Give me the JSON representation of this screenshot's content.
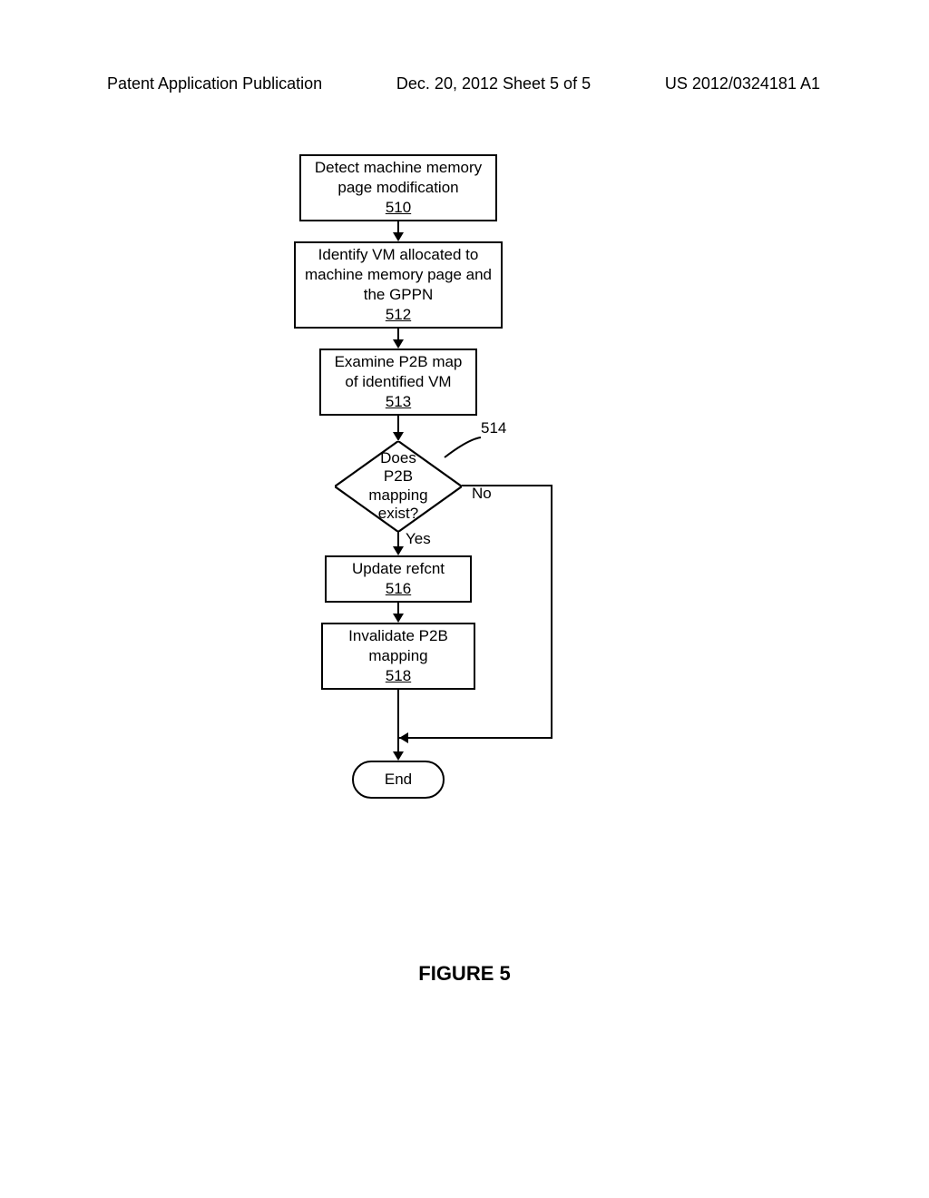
{
  "header": {
    "left": "Patent Application Publication",
    "center": "Dec. 20, 2012  Sheet 5 of 5",
    "right": "US 2012/0324181 A1"
  },
  "boxes": {
    "b510": {
      "text": "Detect machine memory page modification",
      "ref": "510"
    },
    "b512": {
      "text": "Identify VM allocated to machine memory page and the GPPN",
      "ref": "512"
    },
    "b513": {
      "text": "Examine P2B map of identified VM",
      "ref": "513"
    },
    "b514": {
      "text": "Does P2B mapping exist?",
      "ref": "514"
    },
    "b516": {
      "text": "Update refcnt",
      "ref": "516"
    },
    "b518": {
      "text": "Invalidate P2B mapping",
      "ref": "518"
    }
  },
  "labels": {
    "yes": "Yes",
    "no": "No",
    "end": "End"
  },
  "figure": "FIGURE 5",
  "chart_data": {
    "type": "flowchart",
    "nodes": [
      {
        "id": "510",
        "shape": "process",
        "text": "Detect machine memory page modification"
      },
      {
        "id": "512",
        "shape": "process",
        "text": "Identify VM allocated to machine memory page and the GPPN"
      },
      {
        "id": "513",
        "shape": "process",
        "text": "Examine P2B map of identified VM"
      },
      {
        "id": "514",
        "shape": "decision",
        "text": "Does P2B mapping exist?"
      },
      {
        "id": "516",
        "shape": "process",
        "text": "Update refcnt"
      },
      {
        "id": "518",
        "shape": "process",
        "text": "Invalidate P2B mapping"
      },
      {
        "id": "end",
        "shape": "terminal",
        "text": "End"
      }
    ],
    "edges": [
      {
        "from": "510",
        "to": "512"
      },
      {
        "from": "512",
        "to": "513"
      },
      {
        "from": "513",
        "to": "514"
      },
      {
        "from": "514",
        "to": "516",
        "label": "Yes"
      },
      {
        "from": "514",
        "to": "end",
        "label": "No"
      },
      {
        "from": "516",
        "to": "518"
      },
      {
        "from": "518",
        "to": "end"
      }
    ]
  }
}
